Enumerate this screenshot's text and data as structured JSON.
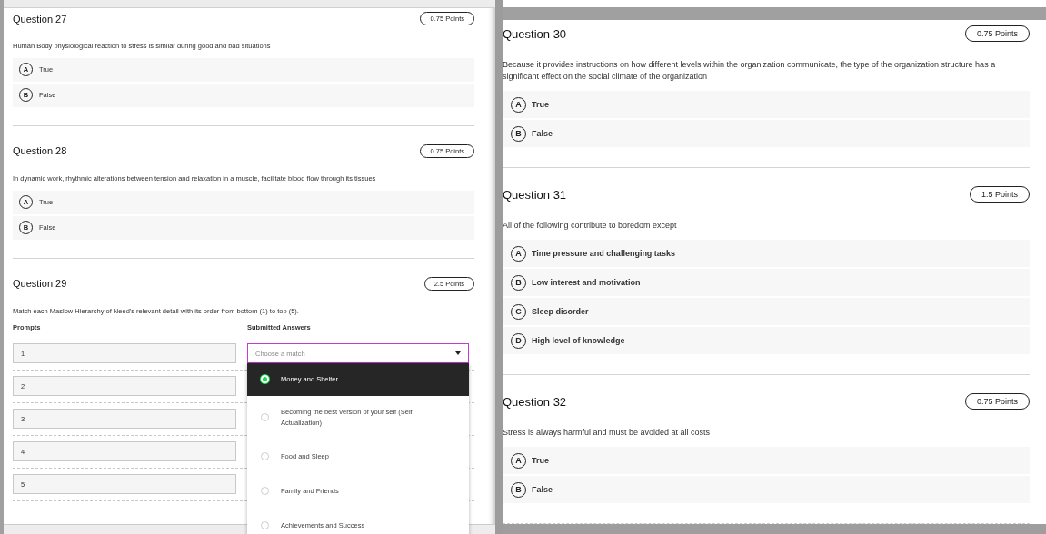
{
  "panels": [
    {
      "questions": [
        {
          "kind": "choice",
          "title": "Question 27",
          "points": "0.75 Points",
          "text": "Human Body physiological reaction to stress is similar during good and bad situations",
          "options": [
            {
              "letter": "A",
              "label": "True"
            },
            {
              "letter": "B",
              "label": "False"
            }
          ]
        },
        {
          "kind": "choice",
          "title": "Question 28",
          "points": "0.75 Points",
          "text": "In dynamic work, rhythmic alterations between tension and relaxation in a muscle, facilitate blood flow through its tissues",
          "options": [
            {
              "letter": "A",
              "label": "True"
            },
            {
              "letter": "B",
              "label": "False"
            }
          ]
        },
        {
          "kind": "matching",
          "title": "Question 29",
          "points": "2.5 Points",
          "text": "Match each Maslow Hierarchy of Need's relevant detail with its order from bottom (1) to top (5).",
          "prompts_heading": "Prompts",
          "answers_heading": "Submitted Answers",
          "prompts": [
            "1",
            "2",
            "3",
            "4",
            "5"
          ],
          "select": {
            "placeholder": "Choose a match",
            "expanded": true
          },
          "match_options": [
            {
              "label": "Money and Shelter",
              "selected": true
            },
            {
              "label": "Becoming the best version of your self (Self Actualization)",
              "selected": false
            },
            {
              "label": "Food and Sleep",
              "selected": false
            },
            {
              "label": "Family and Friends",
              "selected": false
            },
            {
              "label": "Achievements and Success",
              "selected": false
            }
          ]
        }
      ]
    },
    {
      "questions": [
        {
          "kind": "choice",
          "title": "Question 30",
          "points": "0.75 Points",
          "text": "Because it provides instructions on how different levels within the organization communicate, the type of the organization structure has a significant effect on the social climate of the organization",
          "options": [
            {
              "letter": "A",
              "label": "True"
            },
            {
              "letter": "B",
              "label": "False"
            }
          ]
        },
        {
          "kind": "choice",
          "title": "Question 31",
          "points": "1.5 Points",
          "text": "All of the following contribute to boredom except",
          "options": [
            {
              "letter": "A",
              "label": "Time pressure and challenging tasks"
            },
            {
              "letter": "B",
              "label": "Low interest and motivation"
            },
            {
              "letter": "C",
              "label": "Sleep disorder"
            },
            {
              "letter": "D",
              "label": "High level of knowledge"
            }
          ]
        },
        {
          "kind": "choice",
          "title": "Question 32",
          "points": "0.75 Points",
          "text": "Stress is always harmful and must be avoided at all costs",
          "options": [
            {
              "letter": "A",
              "label": "True"
            },
            {
              "letter": "B",
              "label": "False"
            }
          ]
        }
      ]
    }
  ]
}
